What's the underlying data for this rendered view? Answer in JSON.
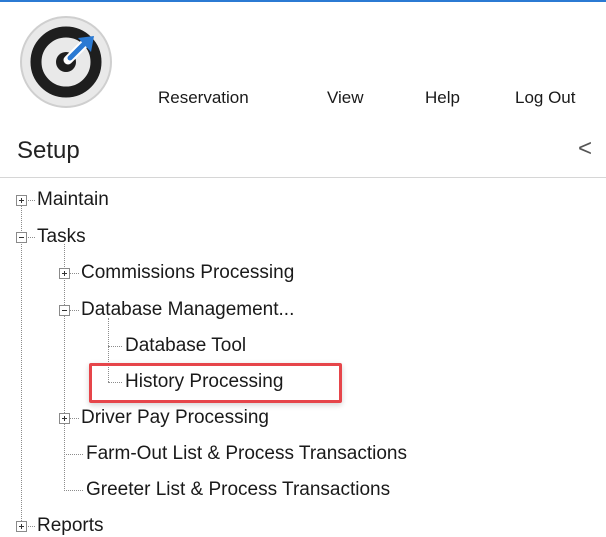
{
  "menu": {
    "items": [
      "Reservation",
      "View",
      "Help",
      "Log Out"
    ]
  },
  "header": {
    "title": "Setup",
    "collapse_glyph": "<"
  },
  "tree": {
    "maintain": "Maintain",
    "tasks": "Tasks",
    "commissions": "Commissions Processing",
    "database_management": "Database Management...",
    "database_tool": "Database Tool",
    "history_processing": "History Processing",
    "driver_pay": "Driver Pay Processing",
    "farm_out": "Farm-Out List & Process Transactions",
    "greeter": "Greeter List & Process Transactions",
    "reports": "Reports"
  },
  "colors": {
    "accent_line": "#2b7ad3",
    "highlight_border": "#e6454a",
    "logo_arrow": "#2b7ad3"
  },
  "icons": [
    "app-logo-icon",
    "chevron-left-icon",
    "plus-expander-icon",
    "minus-expander-icon"
  ]
}
